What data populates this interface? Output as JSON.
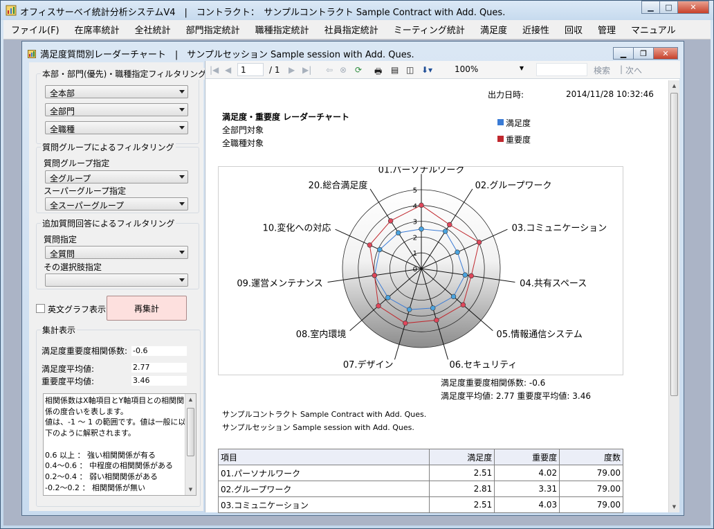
{
  "window": {
    "title": "オフィスサーベイ統計分析システムV4　|　コントラクト：　サンプルコントラクト Sample Contract with Add. Ques."
  },
  "menu": [
    "ファイル(F)",
    "在席率統計",
    "全社統計",
    "部門指定統計",
    "職種指定統計",
    "社員指定統計",
    "ミーティング統計",
    "満足度",
    "近接性",
    "回収",
    "管理",
    "マニュアル"
  ],
  "child_window": {
    "title": "満足度質問別レーダーチャート　|　サンプルセッション Sample session with Add. Ques."
  },
  "filters": {
    "dept_group": {
      "legend": "本部・部門(優先)・職種指定フィルタリング",
      "headquarters": "全本部",
      "department": "全部門",
      "job": "全職種"
    },
    "question_group": {
      "legend": "質問グループによるフィルタリング",
      "group_label": "質問グループ指定",
      "group_value": "全グループ",
      "super_label": "スーパーグループ指定",
      "super_value": "全スーパーグループ"
    },
    "additional": {
      "legend": "追加質問回答によるフィルタリング",
      "question_label": "質問指定",
      "question_value": "全質問",
      "option_label": "その選択肢指定",
      "option_value": ""
    },
    "english_graph_label": "英文グラフ表示",
    "recalc_label": "再集計"
  },
  "summary": {
    "legend": "集計表示",
    "corr_label": "満足度重要度相関係数:",
    "corr_value": "-0.6",
    "sat_label": "満足度平均値:",
    "sat_value": "2.77",
    "imp_label": "重要度平均値:",
    "imp_value": "3.46",
    "memo": "相関係数はX軸項目とY軸項目との相関関係の度合いを表します。\n値は、-1 ～ 1 の範囲です。値は一般に以下のように解釈されます。\n\n0.6 以上 ： 強い相関関係が有る\n0.4～0.6 ： 中程度の相関関係がある\n0.2～0.4 ： 弱い相関関係がある\n-0.2～0.2 ： 相関関係が無い"
  },
  "report_toolbar": {
    "page": "1",
    "page_total": "/ 1",
    "zoom": "100%",
    "search": "検索",
    "next": "次へ"
  },
  "report": {
    "output_label": "出力日時:",
    "output_value": "2014/11/28 10:32:46",
    "heading": "満足度・重要度 レーダーチャート",
    "scope1": "全部門対象",
    "scope2": "全職種対象",
    "legend_sat": "満足度",
    "legend_imp": "重要度",
    "corr_line": "満足度重要度相関係数:  -0.6",
    "avg_line": "満足度平均値:  2.77   重要度平均値:  3.46",
    "contract": "サンプルコントラクト Sample Contract with Add. Ques.",
    "session": "サンプルセッション Sample session with Add. Ques."
  },
  "colors": {
    "satisfaction": "#3a7bd5",
    "importance": "#c0282e",
    "sat_point": "#4aa3df",
    "imp_point": "#e0475b"
  },
  "chart_data": {
    "type": "radar",
    "rmax": 5,
    "ticks": [
      "0",
      "1",
      "2",
      "3",
      "4",
      "5"
    ],
    "categories": [
      "01.パーソナルワーク",
      "02.グループワーク",
      "03.コミュニケーション",
      "04.共有スペース",
      "05.情報通信システム",
      "06.セキュリティ",
      "07.デザイン",
      "08.室内環境",
      "09.運営メンテナンス",
      "10.変化への対応",
      "20.総合満足度"
    ],
    "series": [
      {
        "name": "満足度",
        "values": [
          2.51,
          2.81,
          2.51,
          2.8,
          2.7,
          2.6,
          2.7,
          2.8,
          3.0,
          2.9,
          2.7
        ]
      },
      {
        "name": "重要度",
        "values": [
          4.02,
          3.31,
          4.03,
          3.2,
          3.5,
          3.4,
          3.6,
          3.6,
          3.0,
          3.6,
          3.6
        ]
      }
    ]
  },
  "table": {
    "headers": [
      "項目",
      "満足度",
      "重要度",
      "度数"
    ],
    "rows": [
      [
        "01.パーソナルワーク",
        "2.51",
        "4.02",
        "79.00"
      ],
      [
        "02.グループワーク",
        "2.81",
        "3.31",
        "79.00"
      ],
      [
        "03.コミュニケーション",
        "2.51",
        "4.03",
        "79.00"
      ]
    ]
  }
}
